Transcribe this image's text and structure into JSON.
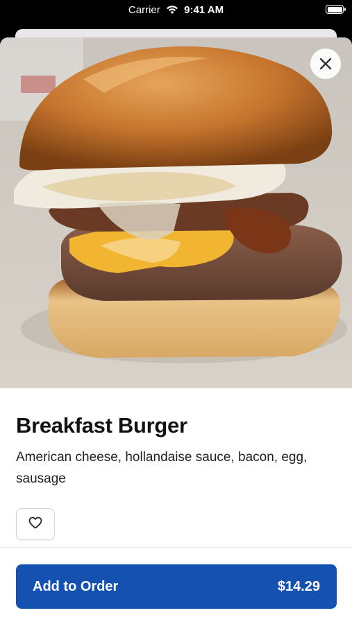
{
  "status_bar": {
    "carrier": "Carrier",
    "time": "9:41 AM",
    "icons": [
      "wifi-icon",
      "battery-icon"
    ]
  },
  "item": {
    "name": "Breakfast Burger",
    "description": "American cheese, hollandaise sauce, bacon, egg, sausage",
    "image_subject": "burger-photo"
  },
  "actions": {
    "close_icon": "close-icon",
    "favorite_icon": "heart-icon",
    "add_label": "Add to Order",
    "price": "$14.29"
  },
  "colors": {
    "primary": "#1551b0",
    "text": "#111111"
  }
}
